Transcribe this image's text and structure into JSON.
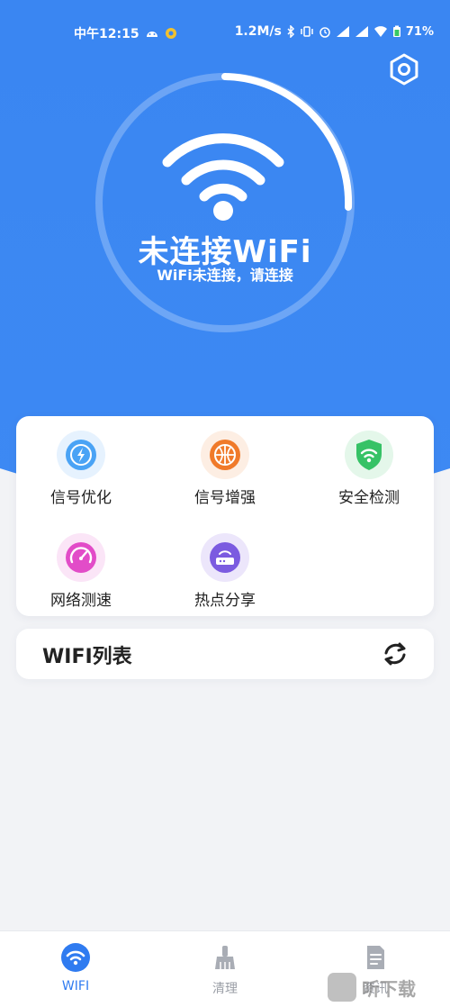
{
  "status_bar": {
    "time": "中午12:15",
    "net_speed": "1.2M/s",
    "battery": "71%"
  },
  "colors": {
    "primary": "#3a86f2",
    "card": "#ffffff",
    "page_bg": "#f2f3f6",
    "tab_active": "#2f7bf0",
    "tab_inactive": "#9a9ea6"
  },
  "header": {
    "status_title": "未连接WiFi",
    "status_subtitle": "WiFi未连接，请连接",
    "settings_icon": "gear-icon"
  },
  "tools": [
    {
      "label": "信号优化",
      "icon": "signal-boost-icon",
      "color": "#4aa3f5"
    },
    {
      "label": "信号增强",
      "icon": "globe-icon",
      "color": "#f07a2a"
    },
    {
      "label": "安全检测",
      "icon": "shield-wifi-icon",
      "color": "#36c266"
    },
    {
      "label": "网络测速",
      "icon": "speedometer-icon",
      "color": "#e24cc8"
    },
    {
      "label": "热点分享",
      "icon": "router-icon",
      "color": "#7b5be0"
    }
  ],
  "wifi_list": {
    "title": "WIFI列表",
    "refresh_icon": "refresh-icon"
  },
  "tabbar": [
    {
      "label": "WIFI",
      "icon": "wifi-icon",
      "active": true
    },
    {
      "label": "清理",
      "icon": "broom-icon",
      "active": false
    },
    {
      "label": "资讯",
      "icon": "document-icon",
      "active": false
    }
  ],
  "watermark": {
    "text": "听下载"
  }
}
